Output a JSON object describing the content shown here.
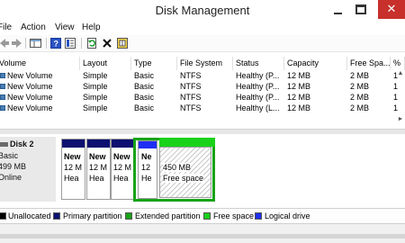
{
  "window": {
    "title": "Disk Management",
    "close_glyph": "✕"
  },
  "menu": [
    "File",
    "Action",
    "View",
    "Help"
  ],
  "toolbar": {
    "icons": [
      "back-arrow-icon",
      "forward-arrow-icon",
      "console-tree-icon",
      "help-icon",
      "properties-icon",
      "refresh-icon",
      "delete-icon",
      "settings-icon"
    ]
  },
  "volume_list": {
    "columns": [
      "Volume",
      "Layout",
      "Type",
      "File System",
      "Status",
      "Capacity",
      "Free Spa...",
      "%"
    ],
    "rows": [
      [
        "New Volume",
        "Simple",
        "Basic",
        "NTFS",
        "Healthy (P...",
        "12 MB",
        "2 MB",
        "1"
      ],
      [
        "New Volume",
        "Simple",
        "Basic",
        "NTFS",
        "Healthy (P...",
        "12 MB",
        "2 MB",
        "1"
      ],
      [
        "New Volume",
        "Simple",
        "Basic",
        "NTFS",
        "Healthy (P...",
        "12 MB",
        "2 MB",
        "1"
      ],
      [
        "New Volume",
        "Simple",
        "Basic",
        "NTFS",
        "Healthy (L...",
        "12 MB",
        "2 MB",
        "1"
      ]
    ],
    "scroll_right_glyph": "►",
    "scroll_up_glyph": "▲"
  },
  "disk_map": {
    "disk": {
      "name": "Disk 2",
      "type": "Basic",
      "size": "499 MB",
      "status": "Online"
    },
    "partitions": [
      {
        "name": "New",
        "size": "12 M",
        "status": "Hea"
      },
      {
        "name": "New",
        "size": "12 M",
        "status": "Hea"
      },
      {
        "name": "New",
        "size": "12 M",
        "status": "Hea"
      }
    ],
    "logical": {
      "name": "Ne",
      "size": "12",
      "status": "He"
    },
    "free": {
      "size": "450 MB",
      "label": "Free space"
    }
  },
  "legend": [
    {
      "label": "Unallocated",
      "color": "#000000"
    },
    {
      "label": "Primary partition",
      "color": "#0d1070"
    },
    {
      "label": "Extended partition",
      "color": "#18a318"
    },
    {
      "label": "Free space",
      "color": "#1ad21a"
    },
    {
      "label": "Logical drive",
      "color": "#1f2ef3"
    }
  ]
}
